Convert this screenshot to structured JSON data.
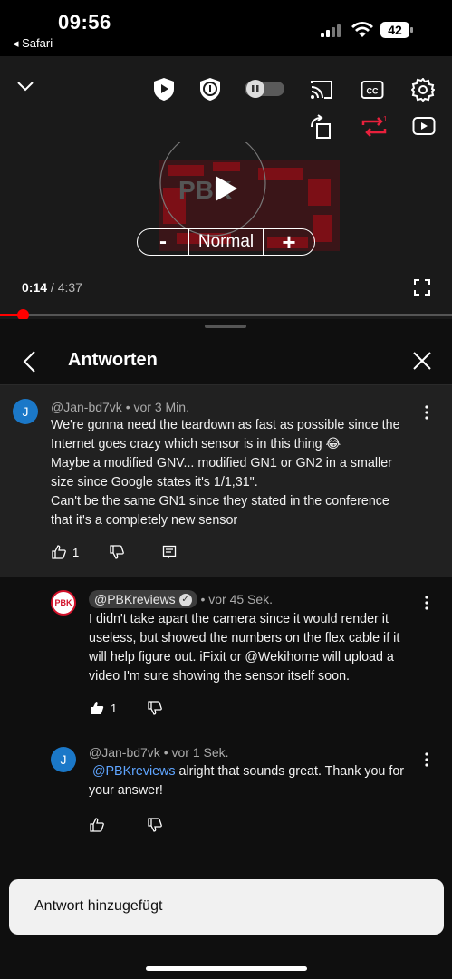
{
  "status_bar": {
    "time": "09:56",
    "back_app": "◂ Safari",
    "battery": "42"
  },
  "player": {
    "speed": {
      "minus": "-",
      "value": "Normal",
      "plus": "+"
    },
    "current_time": "0:14",
    "duration": "/ 4:37",
    "progress_fraction": 0.05
  },
  "panel": {
    "title": "Antworten"
  },
  "comments": [
    {
      "author": "@Jan-bd7vk",
      "age": "• vor 3 Min.",
      "avatar_letter": "J",
      "lines": [
        "We're gonna need the teardown as fast as possible since the",
        "Internet goes crazy which sensor is in this thing 😂",
        "Maybe a modified GNV... modified GN1 or GN2 in a smaller",
        "size since Google states it's 1/1,31\".",
        "Can't be the same GN1 since they stated in the conference",
        "that it's a completely new sensor"
      ],
      "likes": "1"
    },
    {
      "author": "@PBKreviews",
      "age": "• vor 45 Sek.",
      "avatar_text": "PBK",
      "lines": [
        "I didn't take apart the camera since it would render it",
        "useless, but showed the numbers on the flex cable if it",
        "will help figure out. iFixit or @Wekihome will upload a",
        "video I'm sure showing the sensor itself soon."
      ],
      "likes": "1"
    },
    {
      "author": "@Jan-bd7vk",
      "age": "• vor 1 Sek.",
      "avatar_letter": "J",
      "mention": "@PBKreviews",
      "line1_rest": " alright that sounds great. Thank you for",
      "line2": "your answer!"
    }
  ],
  "toast": {
    "text": "Antwort hinzugefügt"
  },
  "colors": {
    "accent_red": "#ff0000",
    "mention_blue": "#5fa5ff",
    "avatar_blue": "#1b78c8"
  }
}
